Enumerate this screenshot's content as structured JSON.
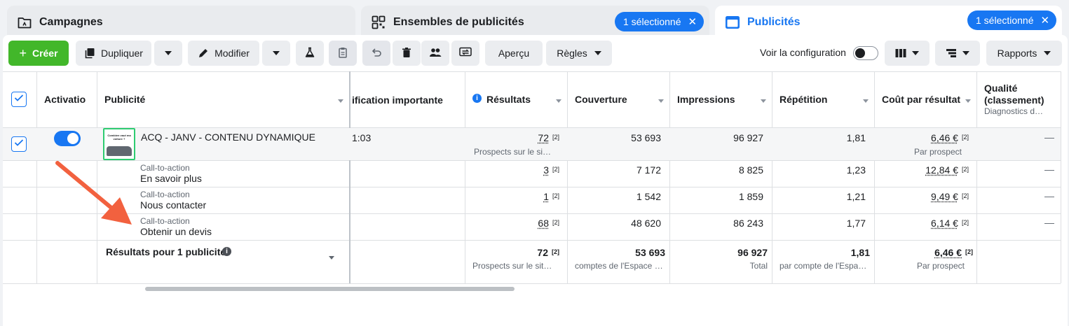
{
  "tabs": [
    {
      "label": "Campagnes"
    },
    {
      "label": "Ensembles de publicités",
      "badge": "1 sélectionné"
    },
    {
      "label": "Publicités",
      "badge": "1 sélectionné"
    }
  ],
  "toolbar": {
    "create": "Créer",
    "duplicate": "Dupliquer",
    "edit": "Modifier",
    "preview": "Aperçu",
    "rules": "Règles",
    "view_config": "Voir la configuration",
    "reports": "Rapports"
  },
  "columns": {
    "activation": "Activatio",
    "ad": "Publicité",
    "notice": "ification importante",
    "results": "Résultats",
    "reach": "Couverture",
    "impressions": "Impressions",
    "frequency": "Répétition",
    "cost": "Coût par résultat",
    "quality": "Qualité (classement)",
    "quality_line1": "Qualité",
    "quality_line2": "(classement)",
    "quality_sub": "Diagnostics d…"
  },
  "ad_row": {
    "name": "ACQ - JANV - CONTENU DYNAMIQUE",
    "notice": "1:03",
    "results": "72",
    "results_sub": "Prospects sur le si…",
    "reach": "53 693",
    "impressions": "96 927",
    "frequency": "1,81",
    "cost": "6,46 €",
    "cost_sub": "Par prospect",
    "quality": "—",
    "ref": "[2]"
  },
  "cta_rows": [
    {
      "label": "Call-to-action",
      "value": "En savoir plus",
      "results": "3",
      "reach": "7 172",
      "impressions": "8 825",
      "frequency": "1,23",
      "cost": "12,84 €",
      "quality": "—",
      "ref": "[2]"
    },
    {
      "label": "Call-to-action",
      "value": "Nous contacter",
      "results": "1",
      "reach": "1 542",
      "impressions": "1 859",
      "frequency": "1,21",
      "cost": "9,49 €",
      "quality": "—",
      "ref": "[2]"
    },
    {
      "label": "Call-to-action",
      "value": "Obtenir un devis",
      "results": "68",
      "reach": "48 620",
      "impressions": "86 243",
      "frequency": "1,77",
      "cost": "6,14 €",
      "quality": "—",
      "ref": "[2]"
    }
  ],
  "totals": {
    "label": "Résultats pour 1 publicité",
    "results": "72",
    "results_sub": "Prospects sur le sit…",
    "reach": "53 693",
    "reach_sub": "comptes de l'Espace C…",
    "impressions": "96 927",
    "impressions_sub": "Total",
    "frequency": "1,81",
    "frequency_sub": "par compte de l'Espac…",
    "cost": "6,46 €",
    "cost_sub": "Par prospect",
    "ref": "[2]"
  },
  "thumbnail_text": "Combien vaut ma voiture ?",
  "colors": {
    "accent": "#1877f2",
    "create": "#42b72a",
    "annotation_arrow": "#f2613f"
  }
}
